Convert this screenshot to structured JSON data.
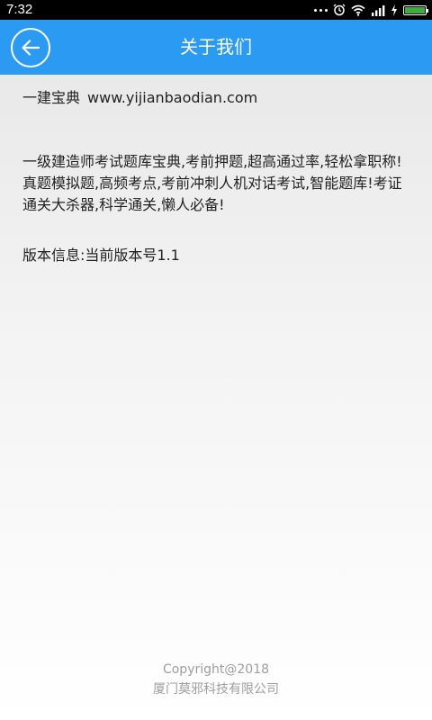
{
  "status_bar": {
    "time": "7:32",
    "battery_level": 1.0,
    "battery_color": "#3fae3f"
  },
  "header": {
    "title": "关于我们",
    "back_icon": "arrow-left-icon",
    "background_color": "#2b9af3"
  },
  "content": {
    "app_name": "一建宝典",
    "website": "www.yijianbaodian.com",
    "description": "一级建造师考试题库宝典,考前押题,超高通过率,轻松拿职称!真题模拟题,高频考点,考前冲刺人机对话考试,智能题库!考证通关大杀器,科学通关,懒人必备!",
    "version_info": "版本信息:当前版本号1.1"
  },
  "footer": {
    "copyright": "Copyright@2018",
    "company": "厦门莫邪科技有限公司"
  }
}
